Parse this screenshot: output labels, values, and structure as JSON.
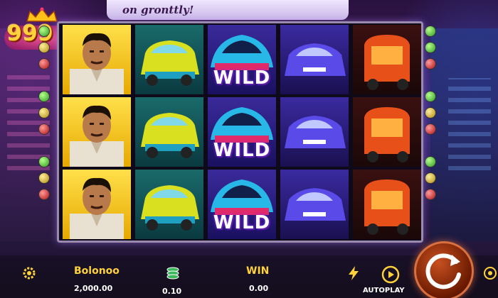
{
  "banner": {
    "text": "on gronttly!"
  },
  "logo": {
    "text": "999"
  },
  "reels": [
    {
      "symbol": "man-portrait",
      "cells": [
        "man",
        "man",
        "man"
      ]
    },
    {
      "symbol": "yellow-green-car",
      "cells": [
        "car",
        "car",
        "car"
      ]
    },
    {
      "symbol": "cyan-sports-car",
      "cells": [
        "WILD",
        "WILD",
        "WILD"
      ]
    },
    {
      "symbol": "blue-car",
      "cells": [
        "car",
        "car",
        "car"
      ]
    },
    {
      "symbol": "orange-tuk-tuk",
      "cells": [
        "tuktuk",
        "tuktuk",
        "tuktuk"
      ]
    }
  ],
  "wild_text": "WILD",
  "bottom": {
    "balance_label": "Bolonoo",
    "balance_value": "2,000.00",
    "bet_value": "0.10",
    "win_label": "WIN",
    "win_value": "0.00",
    "auto_label": "AUTOPLAY"
  },
  "colors": {
    "accent": "#ffd23a",
    "spin": "#c85020",
    "frame": "#9a8ab0"
  }
}
